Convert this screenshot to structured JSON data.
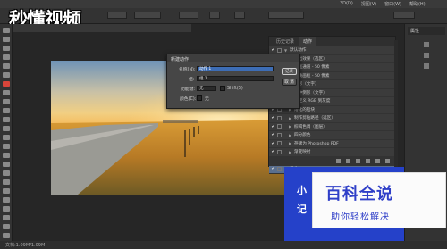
{
  "app": {
    "menus": [
      "3D(D)",
      "视图(V)",
      "窗口(W)",
      "帮助(H)"
    ],
    "watermark": "秒懂视频"
  },
  "panel": {
    "tabs": [
      "历史记录",
      "动作"
    ],
    "right_title": "属性",
    "rows": [
      {
        "label": "默认动作",
        "checked": true,
        "expanded": true,
        "indent": 0
      },
      {
        "label": "淡出效果（选区）",
        "checked": true,
        "expanded": false,
        "indent": 1
      },
      {
        "label": "画框通道 - 50 像素",
        "checked": true,
        "expanded": false,
        "indent": 1
      },
      {
        "label": "木质画框 - 50 像素",
        "checked": true,
        "expanded": false,
        "indent": 1
      },
      {
        "label": "投影（文字）",
        "checked": true,
        "expanded": false,
        "indent": 1
      },
      {
        "label": "水中倒影（文字）",
        "checked": true,
        "expanded": false,
        "indent": 1
      },
      {
        "label": "自定义 RGB 到灰度",
        "checked": true,
        "expanded": false,
        "indent": 1
      },
      {
        "label": "熔化的铅块",
        "checked": true,
        "expanded": false,
        "indent": 1
      },
      {
        "label": "制作剪贴路径（选区）",
        "checked": true,
        "expanded": false,
        "indent": 1
      },
      {
        "label": "棕褐色调（图层）",
        "checked": true,
        "expanded": false,
        "indent": 1
      },
      {
        "label": "四分颜色",
        "checked": true,
        "expanded": false,
        "indent": 1
      },
      {
        "label": "存储为 Photoshop PDF",
        "checked": true,
        "expanded": false,
        "indent": 1
      },
      {
        "label": "渐变映射",
        "checked": true,
        "expanded": false,
        "indent": 1
      },
      {
        "label": "混合器画笔克隆绘图设置",
        "checked": true,
        "expanded": false,
        "indent": 1
      },
      {
        "label": "组 1",
        "checked": true,
        "expanded": false,
        "indent": 0,
        "selected": true
      }
    ]
  },
  "dialog": {
    "title": "新建动作",
    "name_label": "名称(N):",
    "name_value": "动作 1",
    "set_label": "组:",
    "set_value": "组 1",
    "fkey_label": "功能键:",
    "fkey_value": "无",
    "shift_label": "Shift(S)",
    "color_label": "颜色(C):",
    "color_value": "无",
    "record_button": "记录",
    "cancel_button": "取 消"
  },
  "status": {
    "doc": "文档:1.09M/1.09M"
  },
  "banner": {
    "partial_text_1": "小",
    "partial_text_2": "记",
    "title": "百科全说",
    "subtitle": "助你轻松解决"
  }
}
